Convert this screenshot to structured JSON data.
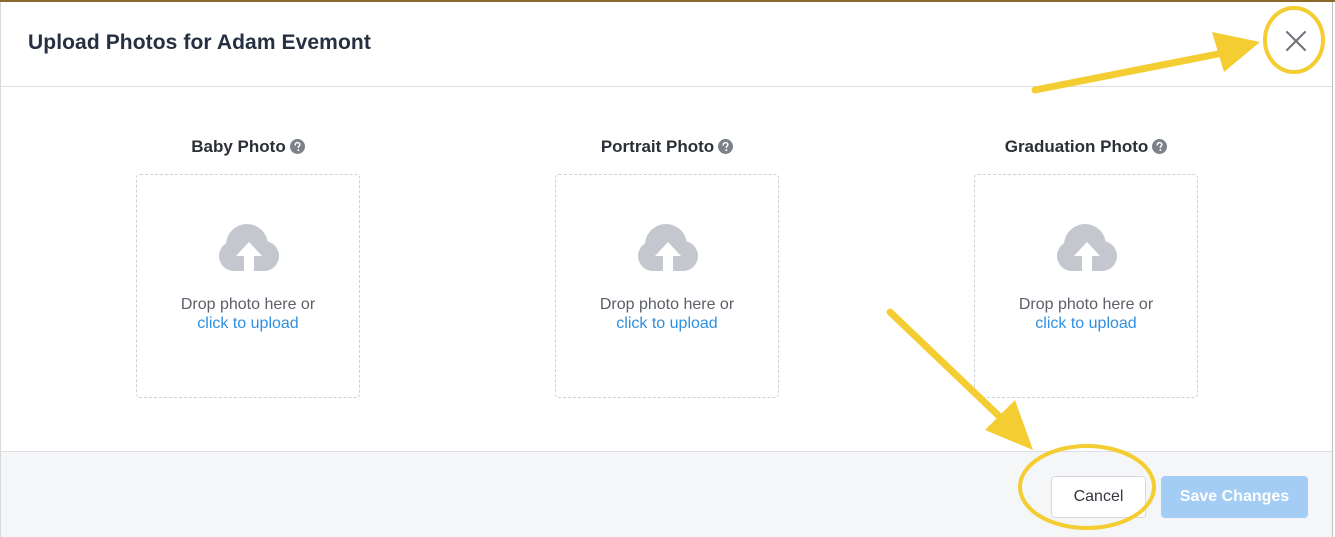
{
  "modal": {
    "title": "Upload Photos for Adam Evemont",
    "close_icon": "close-icon"
  },
  "uploads": [
    {
      "label": "Baby Photo",
      "help_icon": "question-circle-icon",
      "drop_text": "Drop photo here or",
      "link_text": "click to upload",
      "icon": "cloud-upload-icon"
    },
    {
      "label": "Portrait Photo",
      "help_icon": "question-circle-icon",
      "drop_text": "Drop photo here or",
      "link_text": "click to upload",
      "icon": "cloud-upload-icon"
    },
    {
      "label": "Graduation Photo",
      "help_icon": "question-circle-icon",
      "drop_text": "Drop photo here or",
      "link_text": "click to upload",
      "icon": "cloud-upload-icon"
    }
  ],
  "footer": {
    "cancel_label": "Cancel",
    "save_label": "Save Changes"
  },
  "colors": {
    "link": "#2f8fe0",
    "save_button_disabled": "#a3cdf5",
    "annotation": "#f4cd32",
    "cloud_icon": "#c4c8ce"
  }
}
